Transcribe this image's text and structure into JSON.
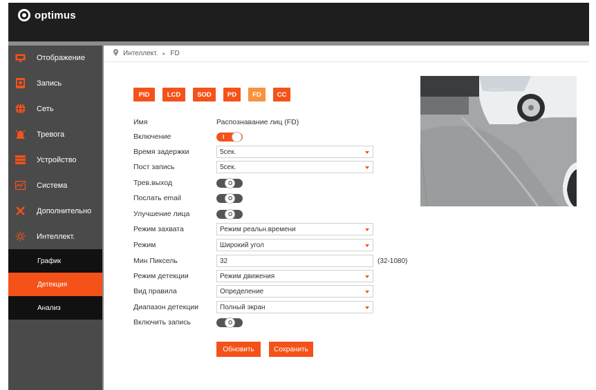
{
  "brand": {
    "name": "optimus"
  },
  "sidebar": {
    "items": [
      {
        "label": "Отображение",
        "icon": "monitor-icon"
      },
      {
        "label": "Запись",
        "icon": "record-icon"
      },
      {
        "label": "Сеть",
        "icon": "globe-icon"
      },
      {
        "label": "Тревога",
        "icon": "alarm-icon"
      },
      {
        "label": "Устройство",
        "icon": "device-icon"
      },
      {
        "label": "Система",
        "icon": "system-icon"
      },
      {
        "label": "Дополнительно",
        "icon": "tools-icon"
      },
      {
        "label": "Интеллект.",
        "icon": "intellect-icon"
      }
    ],
    "submenu": [
      {
        "label": "График",
        "active": false
      },
      {
        "label": "Детекция",
        "active": true
      },
      {
        "label": "Анализ",
        "active": false
      }
    ]
  },
  "breadcrumb": {
    "section": "Интеллект.",
    "page": "FD"
  },
  "tabs": [
    {
      "label": "PID"
    },
    {
      "label": "LCD"
    },
    {
      "label": "SOD"
    },
    {
      "label": "PD"
    },
    {
      "label": "FD",
      "active": true
    },
    {
      "label": "CC"
    }
  ],
  "form": {
    "name": {
      "label": "Имя",
      "value": "Распознавание лиц (FD)"
    },
    "enable": {
      "label": "Включение",
      "toggle": "I",
      "state": "on"
    },
    "delay": {
      "label": "Время задержки",
      "value": "5сек."
    },
    "post_record": {
      "label": "Пост запись",
      "value": "5сек."
    },
    "alarm_out": {
      "label": "Трев.выход",
      "toggle": "O",
      "state": "off"
    },
    "send_email": {
      "label": "Послать email",
      "toggle": "O",
      "state": "off"
    },
    "face_enhance": {
      "label": "Улучшение лица",
      "toggle": "O",
      "state": "off"
    },
    "capture_mode": {
      "label": "Режим захвата",
      "value": "Режим реальн.времени"
    },
    "mode": {
      "label": "Режим",
      "value": "Широкий угол"
    },
    "min_pixel": {
      "label": "Мин Пиксель",
      "value": "32",
      "hint": "(32-1080)"
    },
    "detect_mode": {
      "label": "Режим детекции",
      "value": "Режим движения"
    },
    "rule_type": {
      "label": "Вид правила",
      "value": "Определение"
    },
    "detect_range": {
      "label": "Диапазон детекции",
      "value": "Полный экран"
    },
    "enable_record": {
      "label": "Включить запись",
      "toggle": "O",
      "state": "off"
    }
  },
  "buttons": {
    "refresh": "Обновить",
    "save": "Сохранить"
  },
  "colors": {
    "accent": "#f5521a",
    "accent_active": "#f7923e",
    "topbar": "#1e1e1e",
    "sidebar": "#4a4a4a",
    "submenu": "#111111"
  }
}
